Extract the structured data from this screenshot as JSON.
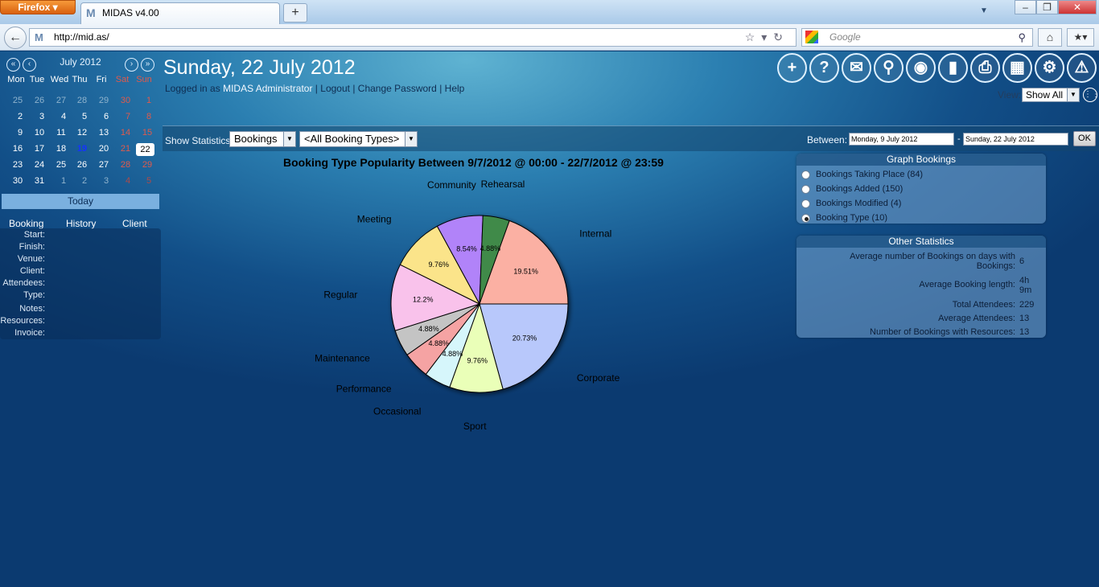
{
  "browser": {
    "menu_button": "Firefox ▾",
    "tab_title": "MIDAS v4.00",
    "new_tab": "+",
    "url": "http://mid.as/",
    "search_placeholder": "Google"
  },
  "calendar": {
    "month": "July 2012",
    "days_of_week": [
      "Mon",
      "Tue",
      "Wed",
      "Thu",
      "Fri",
      "Sat",
      "Sun"
    ],
    "weeks": [
      [
        "25",
        "26",
        "27",
        "28",
        "29",
        "30",
        "1"
      ],
      [
        "2",
        "3",
        "4",
        "5",
        "6",
        "7",
        "8"
      ],
      [
        "9",
        "10",
        "11",
        "12",
        "13",
        "14",
        "15"
      ],
      [
        "16",
        "17",
        "18",
        "19",
        "20",
        "21",
        "22"
      ],
      [
        "23",
        "24",
        "25",
        "26",
        "27",
        "28",
        "29"
      ],
      [
        "30",
        "31",
        "1",
        "2",
        "3",
        "4",
        "5"
      ]
    ],
    "today_button": "Today"
  },
  "booking_tabs": [
    "Booking",
    "History",
    "Client"
  ],
  "booking_fields": [
    "Start:",
    "Finish:",
    "Venue:",
    "Client:",
    "Attendees:",
    "Type:",
    "Notes:",
    "Resources:",
    "Invoice:"
  ],
  "header": {
    "date_title": "Sunday, 22 July 2012",
    "logged_in_prefix": "Logged in as",
    "user": "MIDAS Administrator",
    "sep": "|",
    "logout": "Logout",
    "change_password": "Change Password",
    "help": "Help"
  },
  "toolbar_icons": [
    "add-icon",
    "help-icon",
    "mail-icon",
    "search-icon",
    "view-icon",
    "statistics-icon",
    "print-icon",
    "calculator-icon",
    "settings-icon",
    "alert-icon"
  ],
  "view": {
    "label": "View:",
    "selected": "Show All"
  },
  "stats_bar": {
    "show_label": "Show Statistics:",
    "stat_select": "Bookings",
    "type_select": "<All Booking Types>",
    "between_label": "Between:",
    "date_from": "Monday, 9 July 2012",
    "dash": "-",
    "date_to": "Sunday, 22 July 2012",
    "ok": "OK"
  },
  "chart_data": {
    "type": "pie",
    "title": "Booking Type Popularity Between 9/7/2012 @ 00:00 - 22/7/2012 @ 23:59",
    "slices": [
      {
        "label": "Corporate",
        "value": 20.73,
        "text": "20.73%",
        "color": "#b8c8fb"
      },
      {
        "label": "Sport",
        "value": 9.76,
        "text": "9.76%",
        "color": "#eaffb8"
      },
      {
        "label": "Occasional",
        "value": 4.88,
        "text": "4.88%",
        "color": "#d6f6fb"
      },
      {
        "label": "Performance",
        "value": 4.88,
        "text": "4.88%",
        "color": "#f5a3a3"
      },
      {
        "label": "Maintenance",
        "value": 4.88,
        "text": "4.88%",
        "color": "#c4c4c4"
      },
      {
        "label": "Regular",
        "value": 12.2,
        "text": "12.2%",
        "color": "#f9c2eb"
      },
      {
        "label": "Meeting",
        "value": 9.76,
        "text": "9.76%",
        "color": "#fbe48a"
      },
      {
        "label": "Community",
        "value": 8.54,
        "text": "8.54%",
        "color": "#b183f9"
      },
      {
        "label": "Rehearsal",
        "value": 4.88,
        "text": "4.88%",
        "color": "#3f8a49"
      },
      {
        "label": "Internal",
        "value": 19.51,
        "text": "19.51%",
        "color": "#fbb0a3"
      }
    ]
  },
  "graph_panel": {
    "title": "Graph Bookings",
    "options": [
      {
        "label": "Bookings Taking Place (84)",
        "selected": false
      },
      {
        "label": "Bookings Added (150)",
        "selected": false
      },
      {
        "label": "Bookings Modified (4)",
        "selected": false
      },
      {
        "label": "Booking Type (10)",
        "selected": true
      }
    ]
  },
  "other_stats": {
    "title": "Other Statistics",
    "rows": [
      {
        "label": "Average number of Bookings on days with Bookings:",
        "value": "6"
      },
      {
        "label": "Average Booking length:",
        "value": "4h 9m"
      },
      {
        "label": "Total Attendees:",
        "value": "229"
      },
      {
        "label": "Average Attendees:",
        "value": "13"
      },
      {
        "label": "Number of Bookings with Resources:",
        "value": "13"
      }
    ]
  }
}
